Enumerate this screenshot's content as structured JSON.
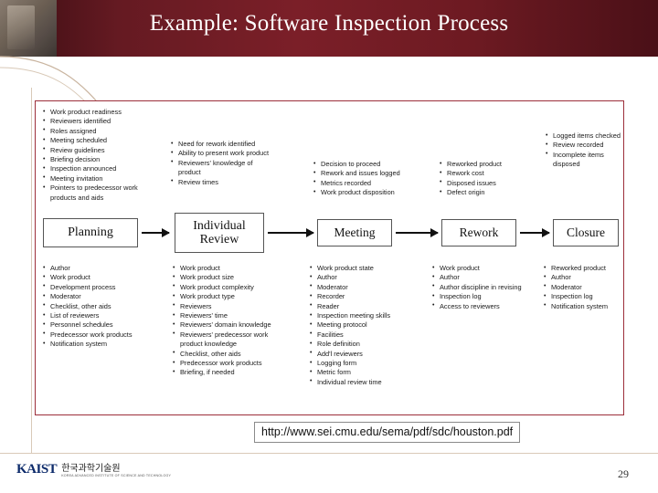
{
  "slide": {
    "title": "Example: Software Inspection Process",
    "number": "29",
    "url": "http://www.sei.cmu.edu/sema/pdf/sdc/houston.pdf",
    "accent_color": "#7b1f28",
    "figure_border_color": "#9c2e3a"
  },
  "footer": {
    "logo_mark": "KAIST",
    "logo_korean": "한국과학기술원",
    "logo_english": "KOREA ADVANCED INSTITUTE OF SCIENCE AND TECHNOLOGY"
  },
  "process": {
    "steps": [
      {
        "label": "Planning"
      },
      {
        "label": "Individual\nReview"
      },
      {
        "label": "Meeting"
      },
      {
        "label": "Rework"
      },
      {
        "label": "Closure"
      }
    ]
  },
  "entry_criteria": {
    "planning": [
      "Work product readiness",
      "Reviewers identified",
      "Roles assigned",
      "Meeting scheduled",
      "Review guidelines",
      "Briefing decision",
      "Inspection announced",
      "Meeting invitation",
      "Pointers to predecessor work products and aids"
    ],
    "individual_review": [
      "Need for rework identified",
      "Ability to present work product",
      "Reviewers' knowledge of product",
      "Review times"
    ],
    "meeting": [
      "Decision to proceed",
      "Rework and issues logged",
      "Metrics recorded",
      "Work product disposition"
    ],
    "rework": [
      "Reworked product",
      "Rework cost",
      "Disposed issues",
      "Defect origin"
    ],
    "closure": [
      "Logged items checked",
      "Review recorded",
      "Incomplete items disposed"
    ]
  },
  "exit_criteria": {
    "planning": [
      "Author",
      "Work product",
      "Development process",
      "Moderator",
      "Checklist, other aids",
      "List of reviewers",
      "Personnel schedules",
      "Predecessor work products",
      "Notification system"
    ],
    "individual_review": [
      "Work product",
      "Work product size",
      "Work product complexity",
      "Work product type",
      "Reviewers",
      "Reviewers' time",
      "Reviewers' domain knowledge",
      "Reviewers' predecessor work product knowledge",
      "Checklist, other aids",
      "Predecessor work products",
      "Briefing, if needed"
    ],
    "meeting": [
      "Work product state",
      "Author",
      "Moderator",
      "Recorder",
      "Reader",
      "Inspection meeting skills",
      "Meeting protocol",
      "Facilities",
      "Role definition",
      "Add'l reviewers",
      "Logging form",
      "Metric form",
      "Individual review time"
    ],
    "rework": [
      "Work product",
      "Author",
      "Author discipline in revising",
      "Inspection log",
      "Access to reviewers"
    ],
    "closure": [
      "Reworked product",
      "Author",
      "Moderator",
      "Inspection log",
      "Notification system"
    ]
  }
}
